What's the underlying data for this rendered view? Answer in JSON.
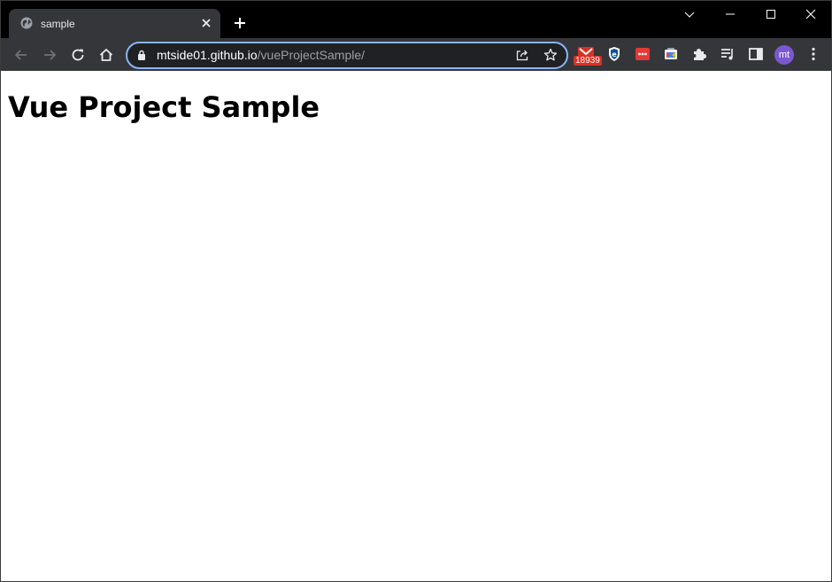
{
  "browser": {
    "tab": {
      "title": "sample"
    },
    "omnibox": {
      "url_host": "mtside01.github.io",
      "url_path": "/vueProjectSample/"
    },
    "extensions": {
      "gmail_badge_count": "18939"
    },
    "profile": {
      "avatar_initials": "mt"
    },
    "colors": {
      "frame": "#000000",
      "toolbar": "#35363a",
      "omnibox_bg": "#202124",
      "focus_ring": "#8ab4f8",
      "avatar": "#7b57d1",
      "badge": "#d93025"
    }
  },
  "page": {
    "heading": "Vue Project Sample"
  }
}
